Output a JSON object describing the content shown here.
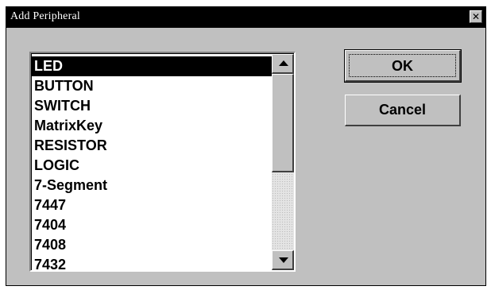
{
  "window": {
    "title": "Add Peripheral",
    "close_glyph": "✕"
  },
  "list": {
    "items": [
      "LED",
      "BUTTON",
      "SWITCH",
      "MatrixKey",
      "RESISTOR",
      "LOGIC",
      "7-Segment",
      "7447",
      "7404",
      "7408",
      "7432"
    ],
    "selected_index": 0
  },
  "scrollbar": {
    "up_icon": "arrow-up-icon",
    "down_icon": "arrow-down-icon"
  },
  "buttons": {
    "ok_label": "OK",
    "cancel_label": "Cancel"
  },
  "colors": {
    "titlebar": "#000000",
    "face": "#c0c0c0",
    "selection": "#000000"
  }
}
